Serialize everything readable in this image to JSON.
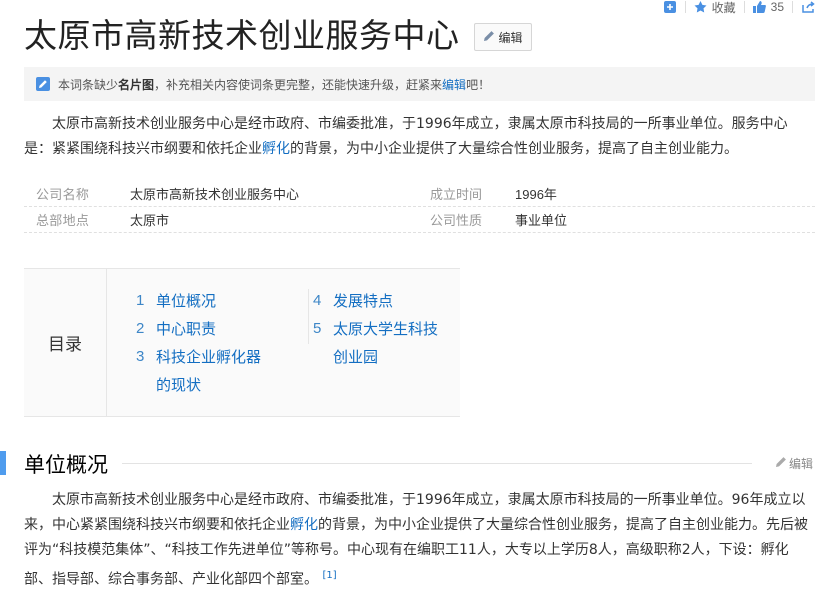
{
  "toolbar": {
    "add_icon": "plus-square-icon",
    "collect_label": "收藏",
    "like_count": "35",
    "share_icon": "share-icon"
  },
  "header": {
    "title": "太原市高新技术创业服务中心",
    "edit_label": "编辑"
  },
  "notice": {
    "prefix": "本词条缺少",
    "bold": "名片图",
    "middle": "，补充相关内容使词条更完整，还能快速升级，赶紧来",
    "link": "编辑",
    "suffix": "吧！"
  },
  "intro": {
    "part1": "　　太原市高新技术创业服务中心是经市政府、市编委批准，于1996年成立，隶属太原市科技局的一所事业单位。服务中心是：紧紧围绕科技兴市纲要和依托企业",
    "link": "孵化",
    "part2": "的背景，为中小企业提供了大量综合性创业服务，提高了自主创业能力。"
  },
  "info": {
    "rows": [
      {
        "k1": "公司名称",
        "v1": "太原市高新技术创业服务中心",
        "k2": "成立时间",
        "v2": "1996年"
      },
      {
        "k1": "总部地点",
        "v1": "太原市",
        "k2": "公司性质",
        "v2": "事业单位"
      }
    ]
  },
  "toc": {
    "label": "目录",
    "items": [
      {
        "num": "1",
        "text": "单位概况"
      },
      {
        "num": "2",
        "text": "中心职责"
      },
      {
        "num": "3",
        "text": "科技企业孵化器"
      },
      {
        "num": "",
        "text": "的现状"
      },
      {
        "num": "4",
        "text": "发展特点"
      },
      {
        "num": "5",
        "text": "太原大学生科技"
      },
      {
        "num": "",
        "text": "创业园"
      }
    ]
  },
  "section": {
    "title": "单位概况",
    "edit_label": "编辑",
    "part1": "　　太原市高新技术创业服务中心是经市政府、市编委批准，于1996年成立，隶属太原市科技局的一所事业单位。96年成立以来，中心紧紧围绕科技兴市纲要和依托企业",
    "link": "孵化",
    "part2": "的背景，为中小企业提供了大量综合性创业服务，提高了自主创业能力。先后被评为“科技模范集体”、“科技工作先进单位”等称号。中心现有在编职工11人，大专以上学历8人，高级职称2人，下设：孵化部、指导部、综合事务部、产业化部四个部室。",
    "ref": "[1]"
  },
  "colors": {
    "accent": "#136ec2",
    "section_bar": "#4f9cee"
  }
}
